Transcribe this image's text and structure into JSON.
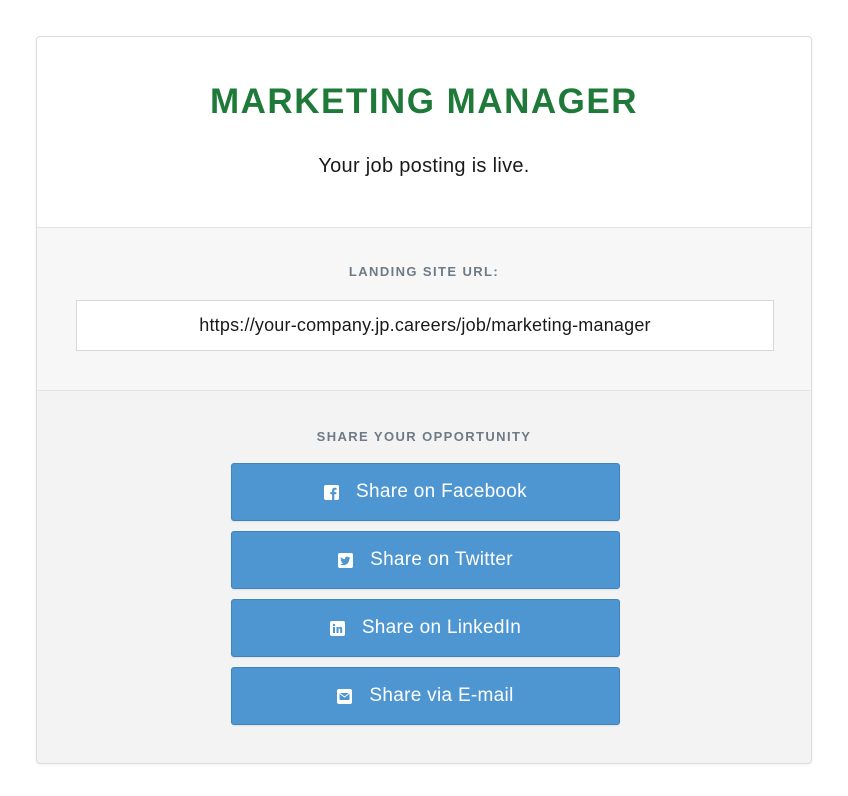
{
  "header": {
    "job_title": "MARKETING MANAGER",
    "status": "Your job posting is live."
  },
  "landing": {
    "label": "LANDING SITE URL:",
    "url": "https://your-company.jp.careers/job/marketing-manager"
  },
  "share": {
    "label": "SHARE YOUR OPPORTUNITY",
    "buttons": [
      {
        "label": "Share on Facebook",
        "icon": "facebook-icon"
      },
      {
        "label": "Share on Twitter",
        "icon": "twitter-icon"
      },
      {
        "label": "Share on LinkedIn",
        "icon": "linkedin-icon"
      },
      {
        "label": "Share via E-mail",
        "icon": "email-icon"
      }
    ]
  },
  "colors": {
    "title_green": "#1f7a3a",
    "button_blue": "#4e96d2",
    "label_gray": "#6e7b87"
  }
}
